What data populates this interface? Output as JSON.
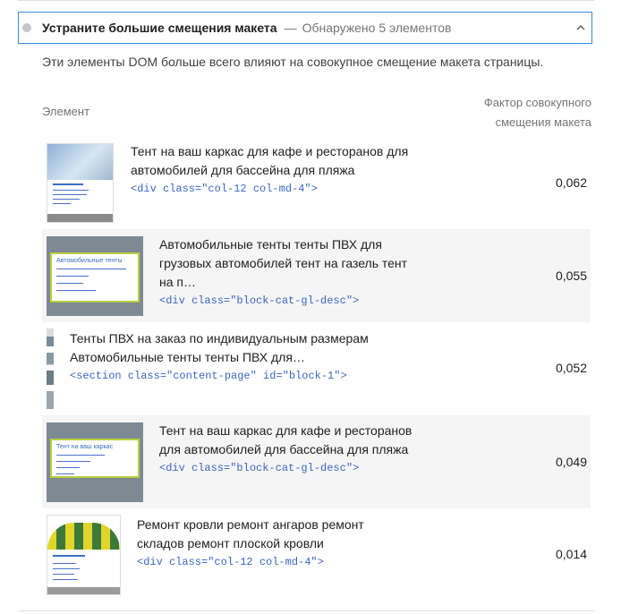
{
  "audit": {
    "title": "Устраните большие смещения макета",
    "separator": "—",
    "found": "Обнаружено 5 элементов",
    "description": "Эти элементы DOM больше всего влияют на совокупное смещение макета страницы.",
    "col_element": "Элемент",
    "col_factor_1": "Фактор совокупного",
    "col_factor_2": "смещения макета",
    "accent": "#3f8ad8"
  },
  "rows": [
    {
      "text_1": "Тент на ваш каркас для кафе и ресторанов для",
      "text_2": "автомобилей для бассейна для пляжа",
      "snippet": "<div class=\"col-12 col-md-4\">",
      "value": "0,062"
    },
    {
      "text_1": "Автомобильные тенты тенты ПВХ для",
      "text_2": "грузовых автомобилей тент на газель тент",
      "text_3": "на п…",
      "snippet": "<div class=\"block-cat-gl-desc\">",
      "value": "0,055",
      "thumb_title": "Автомобильные тенты"
    },
    {
      "text_1": "Тенты ПВХ на заказ по индивидуальным размерам",
      "text_2": "Автомобильные тенты тенты ПВХ для…",
      "snippet": "<section class=\"content-page\" id=\"block-1\">",
      "value": "0,052"
    },
    {
      "text_1": "Тент на ваш каркас для кафе и ресторанов",
      "text_2": "для автомобилей для бассейна для пляжа",
      "snippet": "<div class=\"block-cat-gl-desc\">",
      "value": "0,049",
      "thumb_title": "Тент на ваш каркас"
    },
    {
      "text_1": "Ремонт кровли ремонт ангаров ремонт",
      "text_2": "складов ремонт плоской кровли",
      "snippet": "<div class=\"col-12 col-md-4\">",
      "value": "0,014"
    }
  ]
}
